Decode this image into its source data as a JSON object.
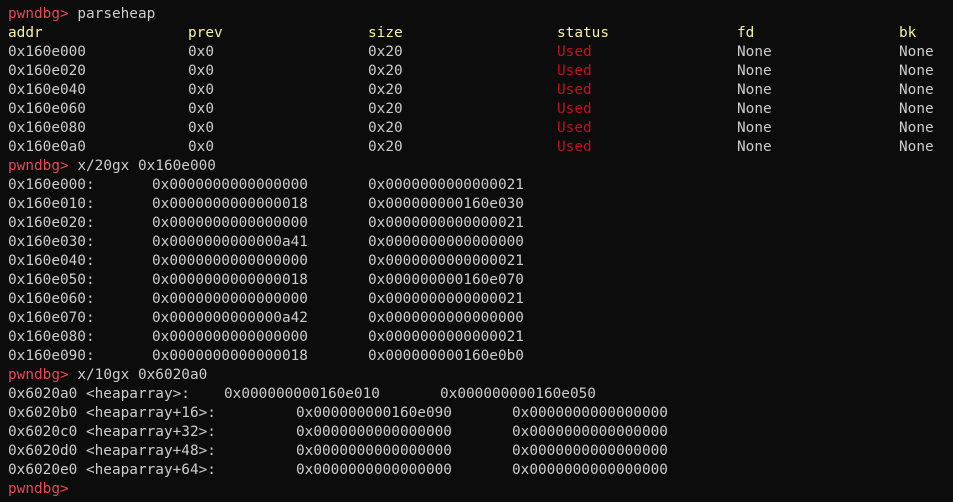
{
  "prompt": "pwndbg>",
  "commands": {
    "parseheap": "parseheap",
    "x20gx": "x/20gx 0x160e000",
    "x10gx": "x/10gx 0x6020a0"
  },
  "parseheap": {
    "headers": [
      "addr",
      "prev",
      "size",
      "status",
      "fd",
      "bk"
    ],
    "rows": [
      [
        "0x160e000",
        "0x0",
        "0x20",
        "Used",
        "None",
        "None"
      ],
      [
        "0x160e020",
        "0x0",
        "0x20",
        "Used",
        "None",
        "None"
      ],
      [
        "0x160e040",
        "0x0",
        "0x20",
        "Used",
        "None",
        "None"
      ],
      [
        "0x160e060",
        "0x0",
        "0x20",
        "Used",
        "None",
        "None"
      ],
      [
        "0x160e080",
        "0x0",
        "0x20",
        "Used",
        "None",
        "None"
      ],
      [
        "0x160e0a0",
        "0x0",
        "0x20",
        "Used",
        "None",
        "None"
      ]
    ]
  },
  "dump1": [
    [
      "0x160e000:",
      "0x0000000000000000",
      "0x0000000000000021"
    ],
    [
      "0x160e010:",
      "0x0000000000000018",
      "0x000000000160e030"
    ],
    [
      "0x160e020:",
      "0x0000000000000000",
      "0x0000000000000021"
    ],
    [
      "0x160e030:",
      "0x0000000000000a41",
      "0x0000000000000000"
    ],
    [
      "0x160e040:",
      "0x0000000000000000",
      "0x0000000000000021"
    ],
    [
      "0x160e050:",
      "0x0000000000000018",
      "0x000000000160e070"
    ],
    [
      "0x160e060:",
      "0x0000000000000000",
      "0x0000000000000021"
    ],
    [
      "0x160e070:",
      "0x0000000000000a42",
      "0x0000000000000000"
    ],
    [
      "0x160e080:",
      "0x0000000000000000",
      "0x0000000000000021"
    ],
    [
      "0x160e090:",
      "0x0000000000000018",
      "0x000000000160e0b0"
    ]
  ],
  "dump2": [
    [
      "0x6020a0 <heaparray>:",
      "0x000000000160e010",
      "0x000000000160e050"
    ],
    [
      "0x6020b0 <heaparray+16>:",
      "0x000000000160e090",
      "0x0000000000000000"
    ],
    [
      "0x6020c0 <heaparray+32>:",
      "0x0000000000000000",
      "0x0000000000000000"
    ],
    [
      "0x6020d0 <heaparray+48>:",
      "0x0000000000000000",
      "0x0000000000000000"
    ],
    [
      "0x6020e0 <heaparray+64>:",
      "0x0000000000000000",
      "0x0000000000000000"
    ]
  ]
}
